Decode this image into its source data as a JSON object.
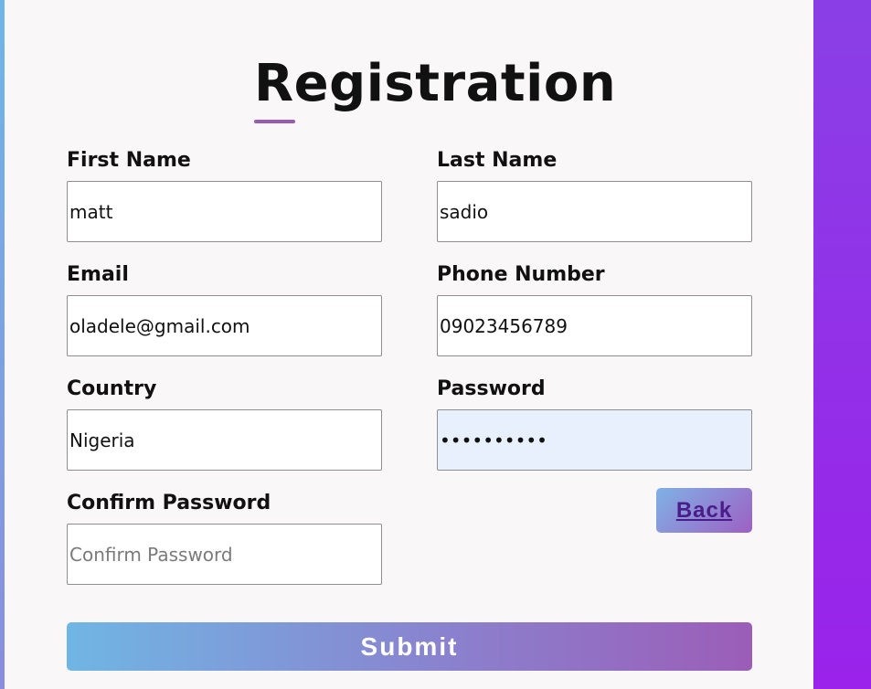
{
  "form": {
    "title": "Registration",
    "fields": {
      "first_name": {
        "label": "First Name",
        "value": "matt",
        "placeholder": "First Name"
      },
      "last_name": {
        "label": "Last Name",
        "value": "sadio",
        "placeholder": "Last Name"
      },
      "email": {
        "label": "Email",
        "value": "oladele@gmail.com",
        "placeholder": "Email"
      },
      "phone": {
        "label": "Phone Number",
        "value": "09023456789",
        "placeholder": "Phone Number"
      },
      "country": {
        "label": "Country",
        "value": "Nigeria",
        "placeholder": "Country"
      },
      "password": {
        "label": "Password",
        "value": "••••••••••",
        "placeholder": "Password"
      },
      "confirm_password": {
        "label": "Confirm Password",
        "value": "",
        "placeholder": "Confirm Password"
      }
    },
    "back_label": "Back",
    "submit_label": "Submit"
  },
  "colors": {
    "accent_purple": "#9b59b6",
    "background_gradient": [
      "#8a3fe6",
      "#9a22ea"
    ],
    "card": "#faf7f8",
    "autofill": "#e8f0fe"
  }
}
